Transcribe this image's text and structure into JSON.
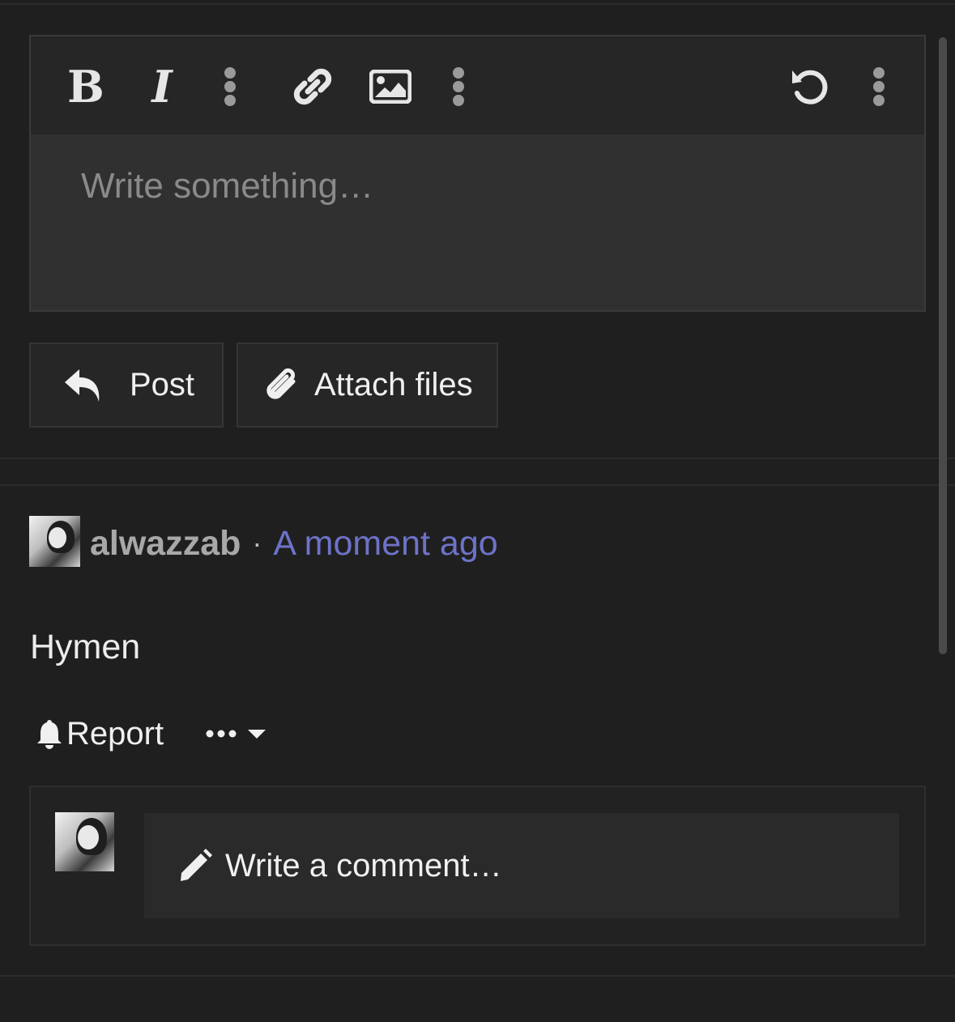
{
  "editor": {
    "toolbar": {
      "bold_label": "B",
      "italic_label": "I",
      "icons": [
        "bold-icon",
        "italic-icon",
        "more-vertical-icon",
        "link-icon",
        "image-icon",
        "more-vertical-icon",
        "undo-icon",
        "more-vertical-icon"
      ]
    },
    "placeholder": "Write something…"
  },
  "actions": {
    "post_label": "Post",
    "attach_label": "Attach files"
  },
  "post": {
    "username": "alwazzab",
    "separator": "·",
    "timestamp": "A moment ago",
    "body": "Hymen",
    "report_label": "Report",
    "more_label": "•••",
    "comment_placeholder": "Write a comment…"
  },
  "colors": {
    "background": "#1f1f1f",
    "accent": "#6e72c8",
    "text": "#f0f0f0",
    "muted": "#8a8a8a"
  }
}
